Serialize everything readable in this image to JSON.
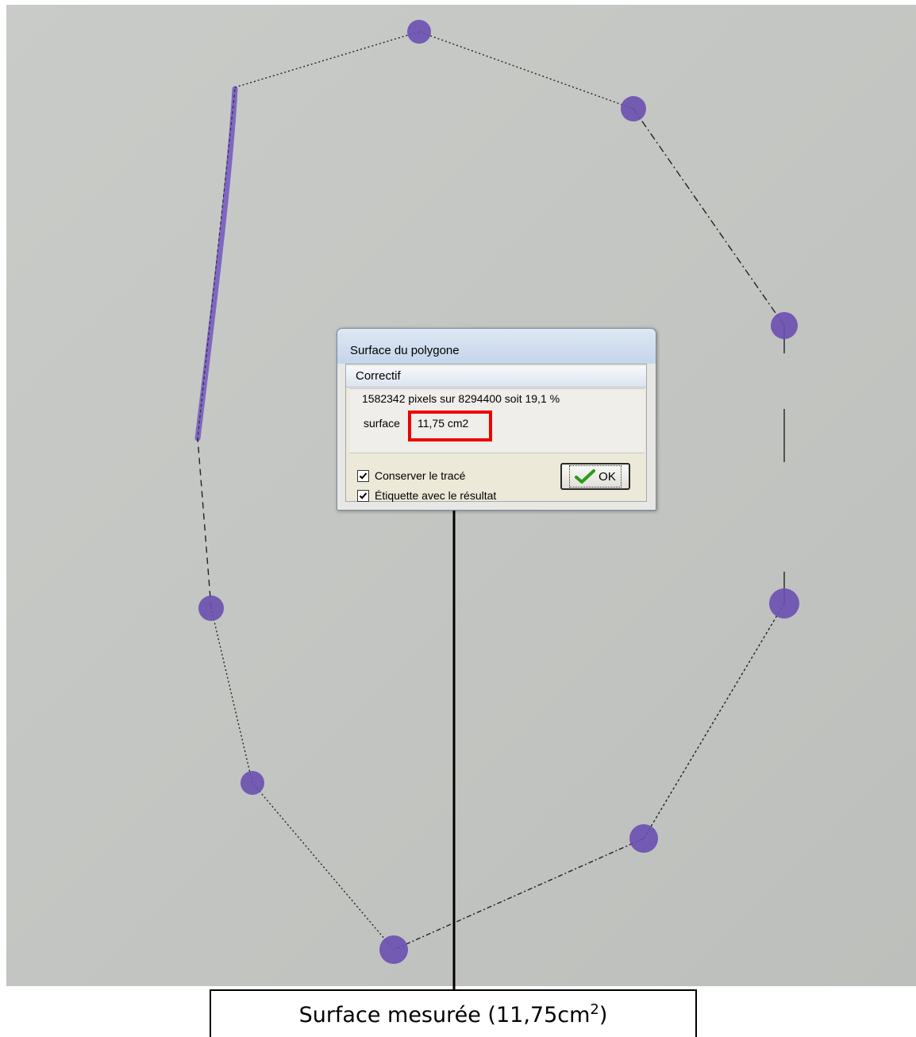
{
  "dialog": {
    "title": "Surface du polygone",
    "header": "Correctif",
    "stats": "1582342 pixels sur 8294400 soit 19,1 %",
    "surface_label": "surface",
    "surface_value": "11,75 cm2",
    "options": [
      {
        "label": "Conserver le tracé",
        "checked": true
      },
      {
        "label": "Étiquette avec le résultat",
        "checked": true
      }
    ],
    "ok_label": "OK"
  },
  "caption": {
    "prefix": "Surface mesurée  (11,75cm",
    "superscript": "2",
    "suffix": ")"
  },
  "colors": {
    "dots": "#6a4fb0",
    "highlight": "#ee0000",
    "ok_check": "#2a9a1a"
  },
  "icons": [
    "checkbox-checked-icon",
    "green-checkmark-icon"
  ]
}
